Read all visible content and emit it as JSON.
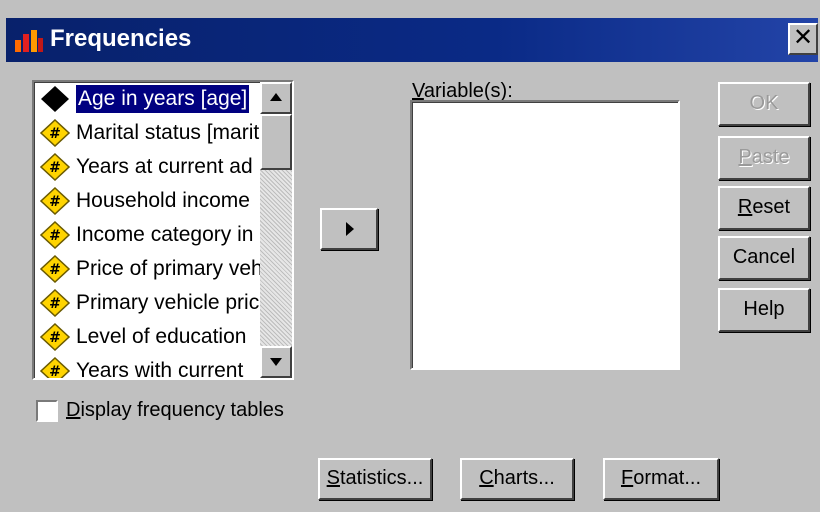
{
  "window": {
    "title": "Frequencies",
    "close_label": "✕"
  },
  "source_list": {
    "items": [
      {
        "label": "Age in years [age]",
        "icon": "scale-variable-icon",
        "selected": true
      },
      {
        "label": "Marital status [marit",
        "icon": "numeric-variable-icon"
      },
      {
        "label": "Years at current ad",
        "icon": "numeric-variable-icon"
      },
      {
        "label": "Household income",
        "icon": "numeric-variable-icon"
      },
      {
        "label": "Income category in",
        "icon": "numeric-variable-icon"
      },
      {
        "label": "Price of primary veh",
        "icon": "numeric-variable-icon"
      },
      {
        "label": "Primary vehicle pric",
        "icon": "numeric-variable-icon"
      },
      {
        "label": "Level of education",
        "icon": "numeric-variable-icon"
      },
      {
        "label": "Years with current",
        "icon": "numeric-variable-icon"
      }
    ]
  },
  "variables": {
    "label_accel": "V",
    "label_rest": "ariable(s):"
  },
  "buttons": {
    "ok": "OK",
    "paste_accel": "P",
    "paste_rest": "aste",
    "reset_accel": "R",
    "reset_rest": "eset",
    "cancel": "Cancel",
    "help": "Help",
    "statistics_accel": "S",
    "statistics_rest": "tatistics...",
    "charts_accel": "C",
    "charts_rest": "harts...",
    "format_accel": "F",
    "format_rest": "ormat..."
  },
  "checkbox": {
    "label_accel": "D",
    "label_rest": "isplay frequency tables",
    "checked": false
  },
  "colors": {
    "titlebar": "#0a2a86",
    "selection": "#000080",
    "face": "#c0c0c0",
    "icon_yellow": "#ffd400"
  }
}
